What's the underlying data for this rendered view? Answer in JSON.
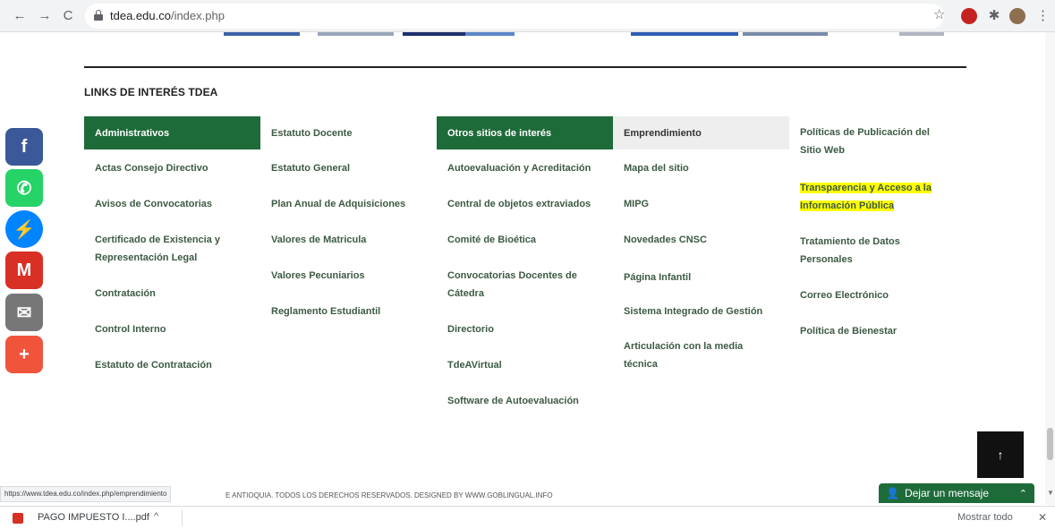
{
  "browser": {
    "back_icon": "←",
    "forward_icon": "→",
    "reload_icon": "C",
    "url_host": "tdea.edu.co",
    "url_path": "/index.php",
    "star_icon": "☆",
    "pin_icon": "✱",
    "menu_icon": "⋮"
  },
  "section": {
    "title": "LINKS DE INTERÉS TDEA"
  },
  "columns": [
    {
      "heading": "Administrativos",
      "links": [
        "Actas Consejo Directivo",
        "Avisos de Convocatorias",
        "Certificado de Existencia y Representación Legal",
        "Contratación",
        "Control Interno",
        "Estatuto de Contratación"
      ]
    },
    {
      "heading": "Estatuto Docente",
      "links": [
        "Estatuto General",
        "Plan Anual de Adquisiciones",
        "Valores de Matricula",
        "Valores Pecuniarios",
        "Reglamento Estudiantil"
      ]
    },
    {
      "heading": "Otros sitios de interés",
      "links": [
        "Autoevaluación y Acreditación",
        "Central de objetos extraviados",
        "Comité de Bioética",
        "Convocatorias Docentes de Cátedra",
        "Directorio",
        "TdeAVirtual",
        "Software de Autoevaluación"
      ]
    },
    {
      "heading": "Emprendimiento",
      "links": [
        "Mapa del sitio",
        "MIPG",
        "Novedades CNSC",
        "Página Infantil",
        "Sistema Integrado de Gestión",
        "Articulación con la media técnica"
      ]
    },
    {
      "heading": "Políticas de Publicación del Sitio Web",
      "links": [
        "Transparencia y Acceso a la Información Pública",
        "Tratamiento de Datos Personales",
        "Correo Electrónico",
        "Política de Bienestar"
      ]
    }
  ],
  "share": {
    "facebook_glyph": "f",
    "whatsapp_glyph": "✆",
    "messenger_glyph": "⚡",
    "gmail_glyph": "M",
    "email_glyph": "✉",
    "more_glyph": "+"
  },
  "back_to_top": "↑",
  "status_url": "https://www.tdea.edu.co/index.php/emprendimiento",
  "footer": "E ANTIOQUIA. TODOS LOS DERECHOS RESERVADOS. DESIGNED BY WWW.GOBLINGUAL.INFO",
  "chat": {
    "label": "Dejar un mensaje",
    "person_icon": "👤",
    "caret": "⌃"
  },
  "download": {
    "file": "PAGO IMPUESTO I....pdf",
    "caret": "^",
    "show_all": "Mostrar todo",
    "close": "✕"
  },
  "colors": {
    "brand_green": "#1e6b3a",
    "highlight": "#ffff00",
    "facebook": "#3b5998",
    "whatsapp": "#25d366",
    "messenger": "#0084ff",
    "gmail": "#d93025",
    "email": "#777777",
    "more": "#f0553c"
  }
}
